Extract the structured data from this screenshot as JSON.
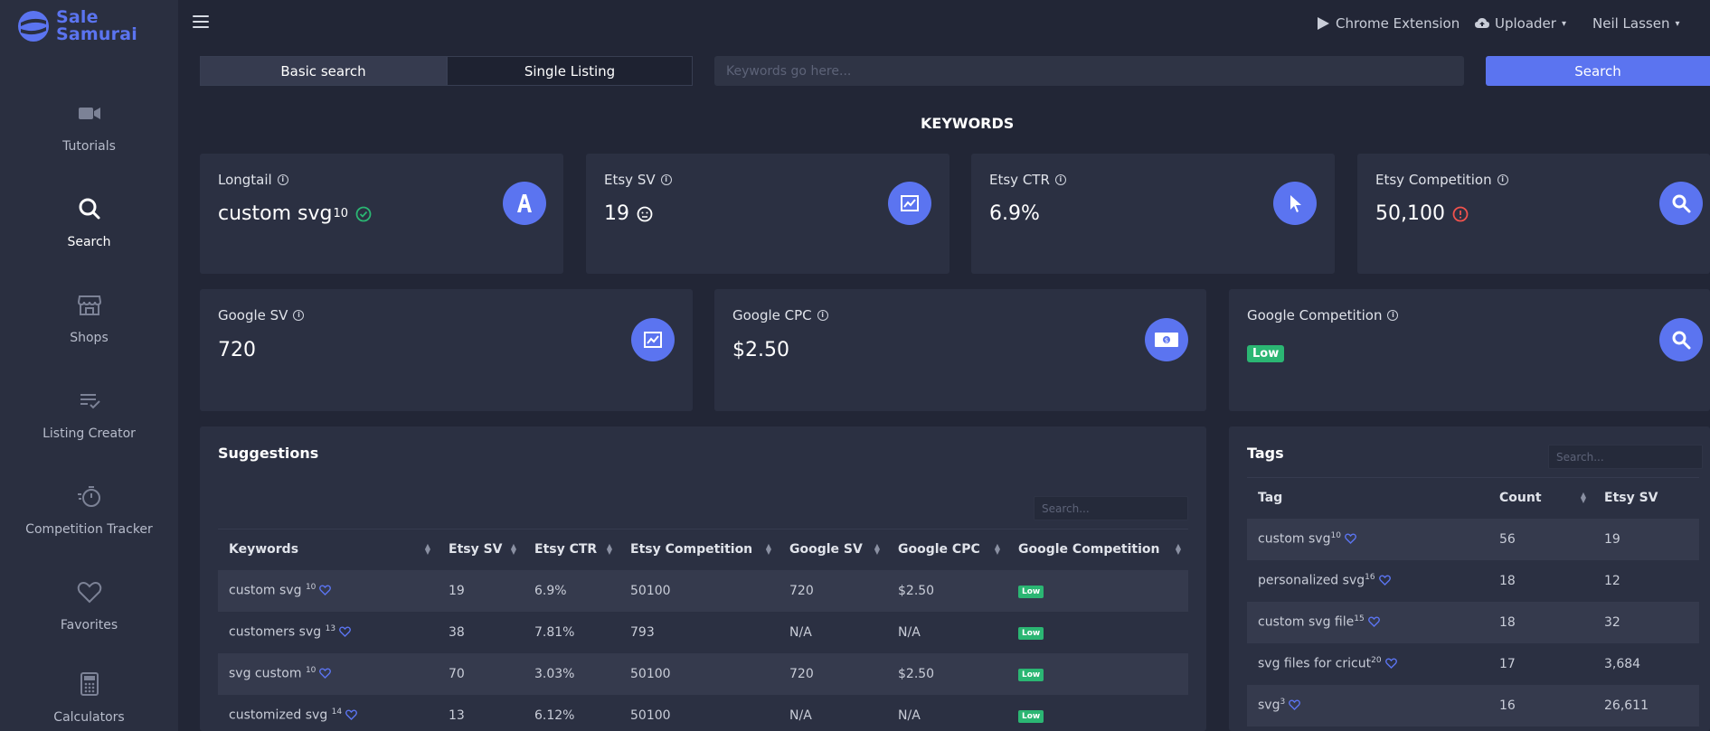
{
  "app": {
    "logo_line1": "Sale",
    "logo_line2": "Samurai",
    "brand_color": "#5b74f0"
  },
  "sidebar": {
    "items": [
      {
        "label": "Tutorials",
        "icon": "video-camera-icon"
      },
      {
        "label": "Search",
        "icon": "search-icon",
        "active": true
      },
      {
        "label": "Shops",
        "icon": "store-icon"
      },
      {
        "label": "Listing Creator",
        "icon": "list-check-icon"
      },
      {
        "label": "Competition Tracker",
        "icon": "stopwatch-icon"
      },
      {
        "label": "Favorites",
        "icon": "heart-icon"
      },
      {
        "label": "Calculators",
        "icon": "calculator-icon"
      }
    ]
  },
  "topbar": {
    "chrome_extension": "Chrome Extension",
    "uploader": "Uploader",
    "user": "Neil Lassen"
  },
  "search": {
    "tab_basic": "Basic search",
    "tab_single": "Single Listing",
    "placeholder": "Keywords go here...",
    "button": "Search"
  },
  "keywords_title": "KEYWORDS",
  "metrics": {
    "longtail": {
      "label": "Longtail",
      "value": "custom svg",
      "sup": "10"
    },
    "etsy_sv": {
      "label": "Etsy SV",
      "value": "19"
    },
    "etsy_ctr": {
      "label": "Etsy CTR",
      "value": "6.9%"
    },
    "etsy_competition": {
      "label": "Etsy Competition",
      "value": "50,100"
    },
    "google_sv": {
      "label": "Google SV",
      "value": "720"
    },
    "google_cpc": {
      "label": "Google CPC",
      "value": "$2.50"
    },
    "google_competition": {
      "label": "Google Competition",
      "value": "Low"
    }
  },
  "suggestions": {
    "title": "Suggestions",
    "search_placeholder": "Search...",
    "columns": [
      "Keywords",
      "Etsy SV",
      "Etsy CTR",
      "Etsy Competition",
      "Google SV",
      "Google CPC",
      "Google Competition"
    ],
    "rows": [
      {
        "keyword": "custom svg",
        "sup": "10",
        "etsy_sv": "19",
        "etsy_ctr": "6.9%",
        "etsy_comp": "50100",
        "google_sv": "720",
        "google_cpc": "$2.50",
        "google_comp": "Low"
      },
      {
        "keyword": "customers svg",
        "sup": "13",
        "etsy_sv": "38",
        "etsy_ctr": "7.81%",
        "etsy_comp": "793",
        "google_sv": "N/A",
        "google_cpc": "N/A",
        "google_comp": "Low"
      },
      {
        "keyword": "svg custom",
        "sup": "10",
        "etsy_sv": "70",
        "etsy_ctr": "3.03%",
        "etsy_comp": "50100",
        "google_sv": "720",
        "google_cpc": "$2.50",
        "google_comp": "Low"
      },
      {
        "keyword": "customized svg",
        "sup": "14",
        "etsy_sv": "13",
        "etsy_ctr": "6.12%",
        "etsy_comp": "50100",
        "google_sv": "N/A",
        "google_cpc": "N/A",
        "google_comp": "Low"
      }
    ]
  },
  "tags": {
    "title": "Tags",
    "search_placeholder": "Search...",
    "columns": [
      "Tag",
      "Count",
      "Etsy SV"
    ],
    "rows": [
      {
        "tag": "custom svg",
        "sup": "10",
        "count": "56",
        "etsy_sv": "19"
      },
      {
        "tag": "personalized svg",
        "sup": "16",
        "count": "18",
        "etsy_sv": "12"
      },
      {
        "tag": "custom svg file",
        "sup": "15",
        "count": "18",
        "etsy_sv": "32"
      },
      {
        "tag": "svg files for cricut",
        "sup": "20",
        "count": "17",
        "etsy_sv": "3,684"
      },
      {
        "tag": "svg",
        "sup": "3",
        "count": "16",
        "etsy_sv": "26,611"
      }
    ]
  }
}
